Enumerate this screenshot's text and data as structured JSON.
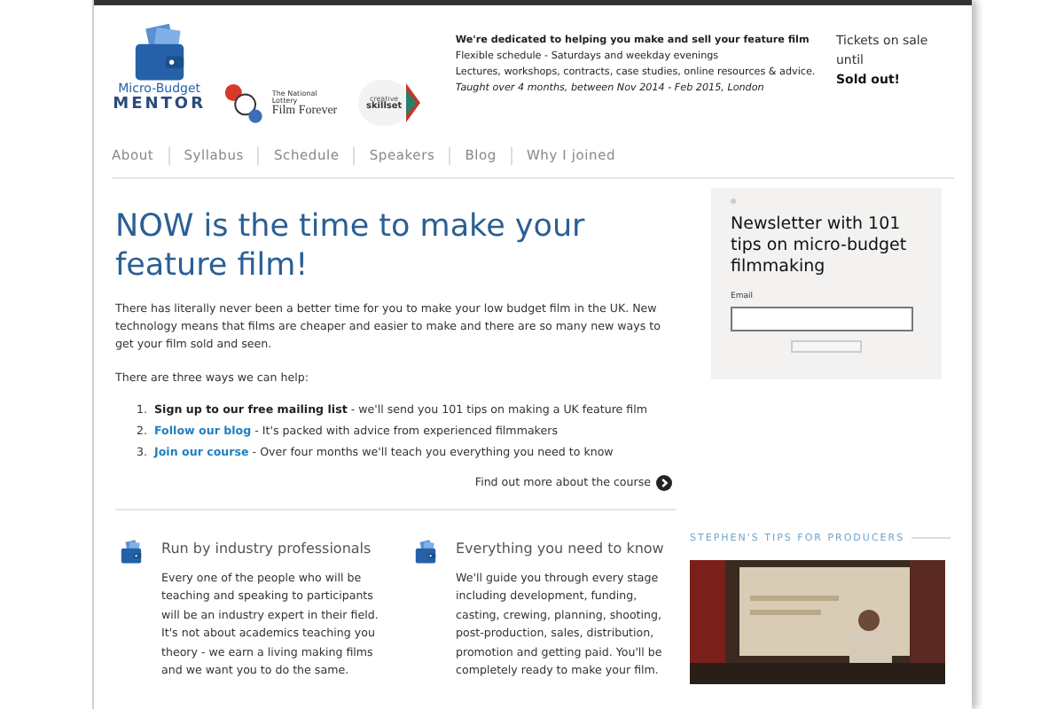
{
  "logo": {
    "line_1": "Micro-Budget",
    "line_2": "MENTOR"
  },
  "partner_logos": [
    {
      "kind": "lottery",
      "small_text": "The National Lottery",
      "main_text": "Film Forever"
    },
    {
      "kind": "skillset",
      "small_text": "creative",
      "main_text": "skillset"
    }
  ],
  "tagline": {
    "headline": "We're dedicated to helping you make and sell your feature film",
    "lines": [
      "Flexible schedule - Saturdays and weekday evenings",
      "Lectures, workshops, contracts, case studies, online resources & advice."
    ],
    "note": "Taught over 4 months, between Nov 2014 - Feb 2015, London"
  },
  "tickets": {
    "label": "Tickets on sale until",
    "status": "Sold out!"
  },
  "nav": [
    {
      "label": "About"
    },
    {
      "label": "Syllabus"
    },
    {
      "label": "Schedule"
    },
    {
      "label": "Speakers"
    },
    {
      "label": "Blog"
    },
    {
      "label": "Why I joined"
    }
  ],
  "intro": {
    "heading": "NOW is the time to make your feature film!",
    "paragraph": "There has literally never been a better time for you to make your low budget film in the UK. New technology means that films are cheaper and easier to make and there are so many new ways to get your film sold and seen.",
    "lead": "There are three ways we can help:",
    "ways": [
      {
        "number": "1.",
        "kind": "bold",
        "title": "Sign up to our free mailing list",
        "text": " - we'll send you 101 tips on making a UK feature film"
      },
      {
        "number": "2.",
        "kind": "link",
        "title": "Follow our blog",
        "text": " - It's packed with advice from experienced filmmakers"
      },
      {
        "number": "3.",
        "kind": "link",
        "title": "Join our course",
        "text": " - Over four months we'll teach you everything you need to know"
      }
    ],
    "more_link": "Find out more about the course"
  },
  "newsletter": {
    "title": "Newsletter with 101 tips on micro-budget filmmaking",
    "email_label": "Email"
  },
  "features": [
    {
      "title": "Run by industry professionals",
      "text": "Every one of the people who will be teaching and speaking to participants will be an industry expert in their field. It's not about academics teaching you theory - we earn a living making films and we want you to do the same."
    },
    {
      "title": "Everything you need to know",
      "text": "We'll guide you through every stage including development, funding, casting, crewing, planning, shooting, post-production, sales, distribution, promotion and getting paid. You'll be completely ready to make your film."
    }
  ],
  "tips": {
    "heading": "STEPHEN'S TIPS FOR PRODUCERS"
  }
}
